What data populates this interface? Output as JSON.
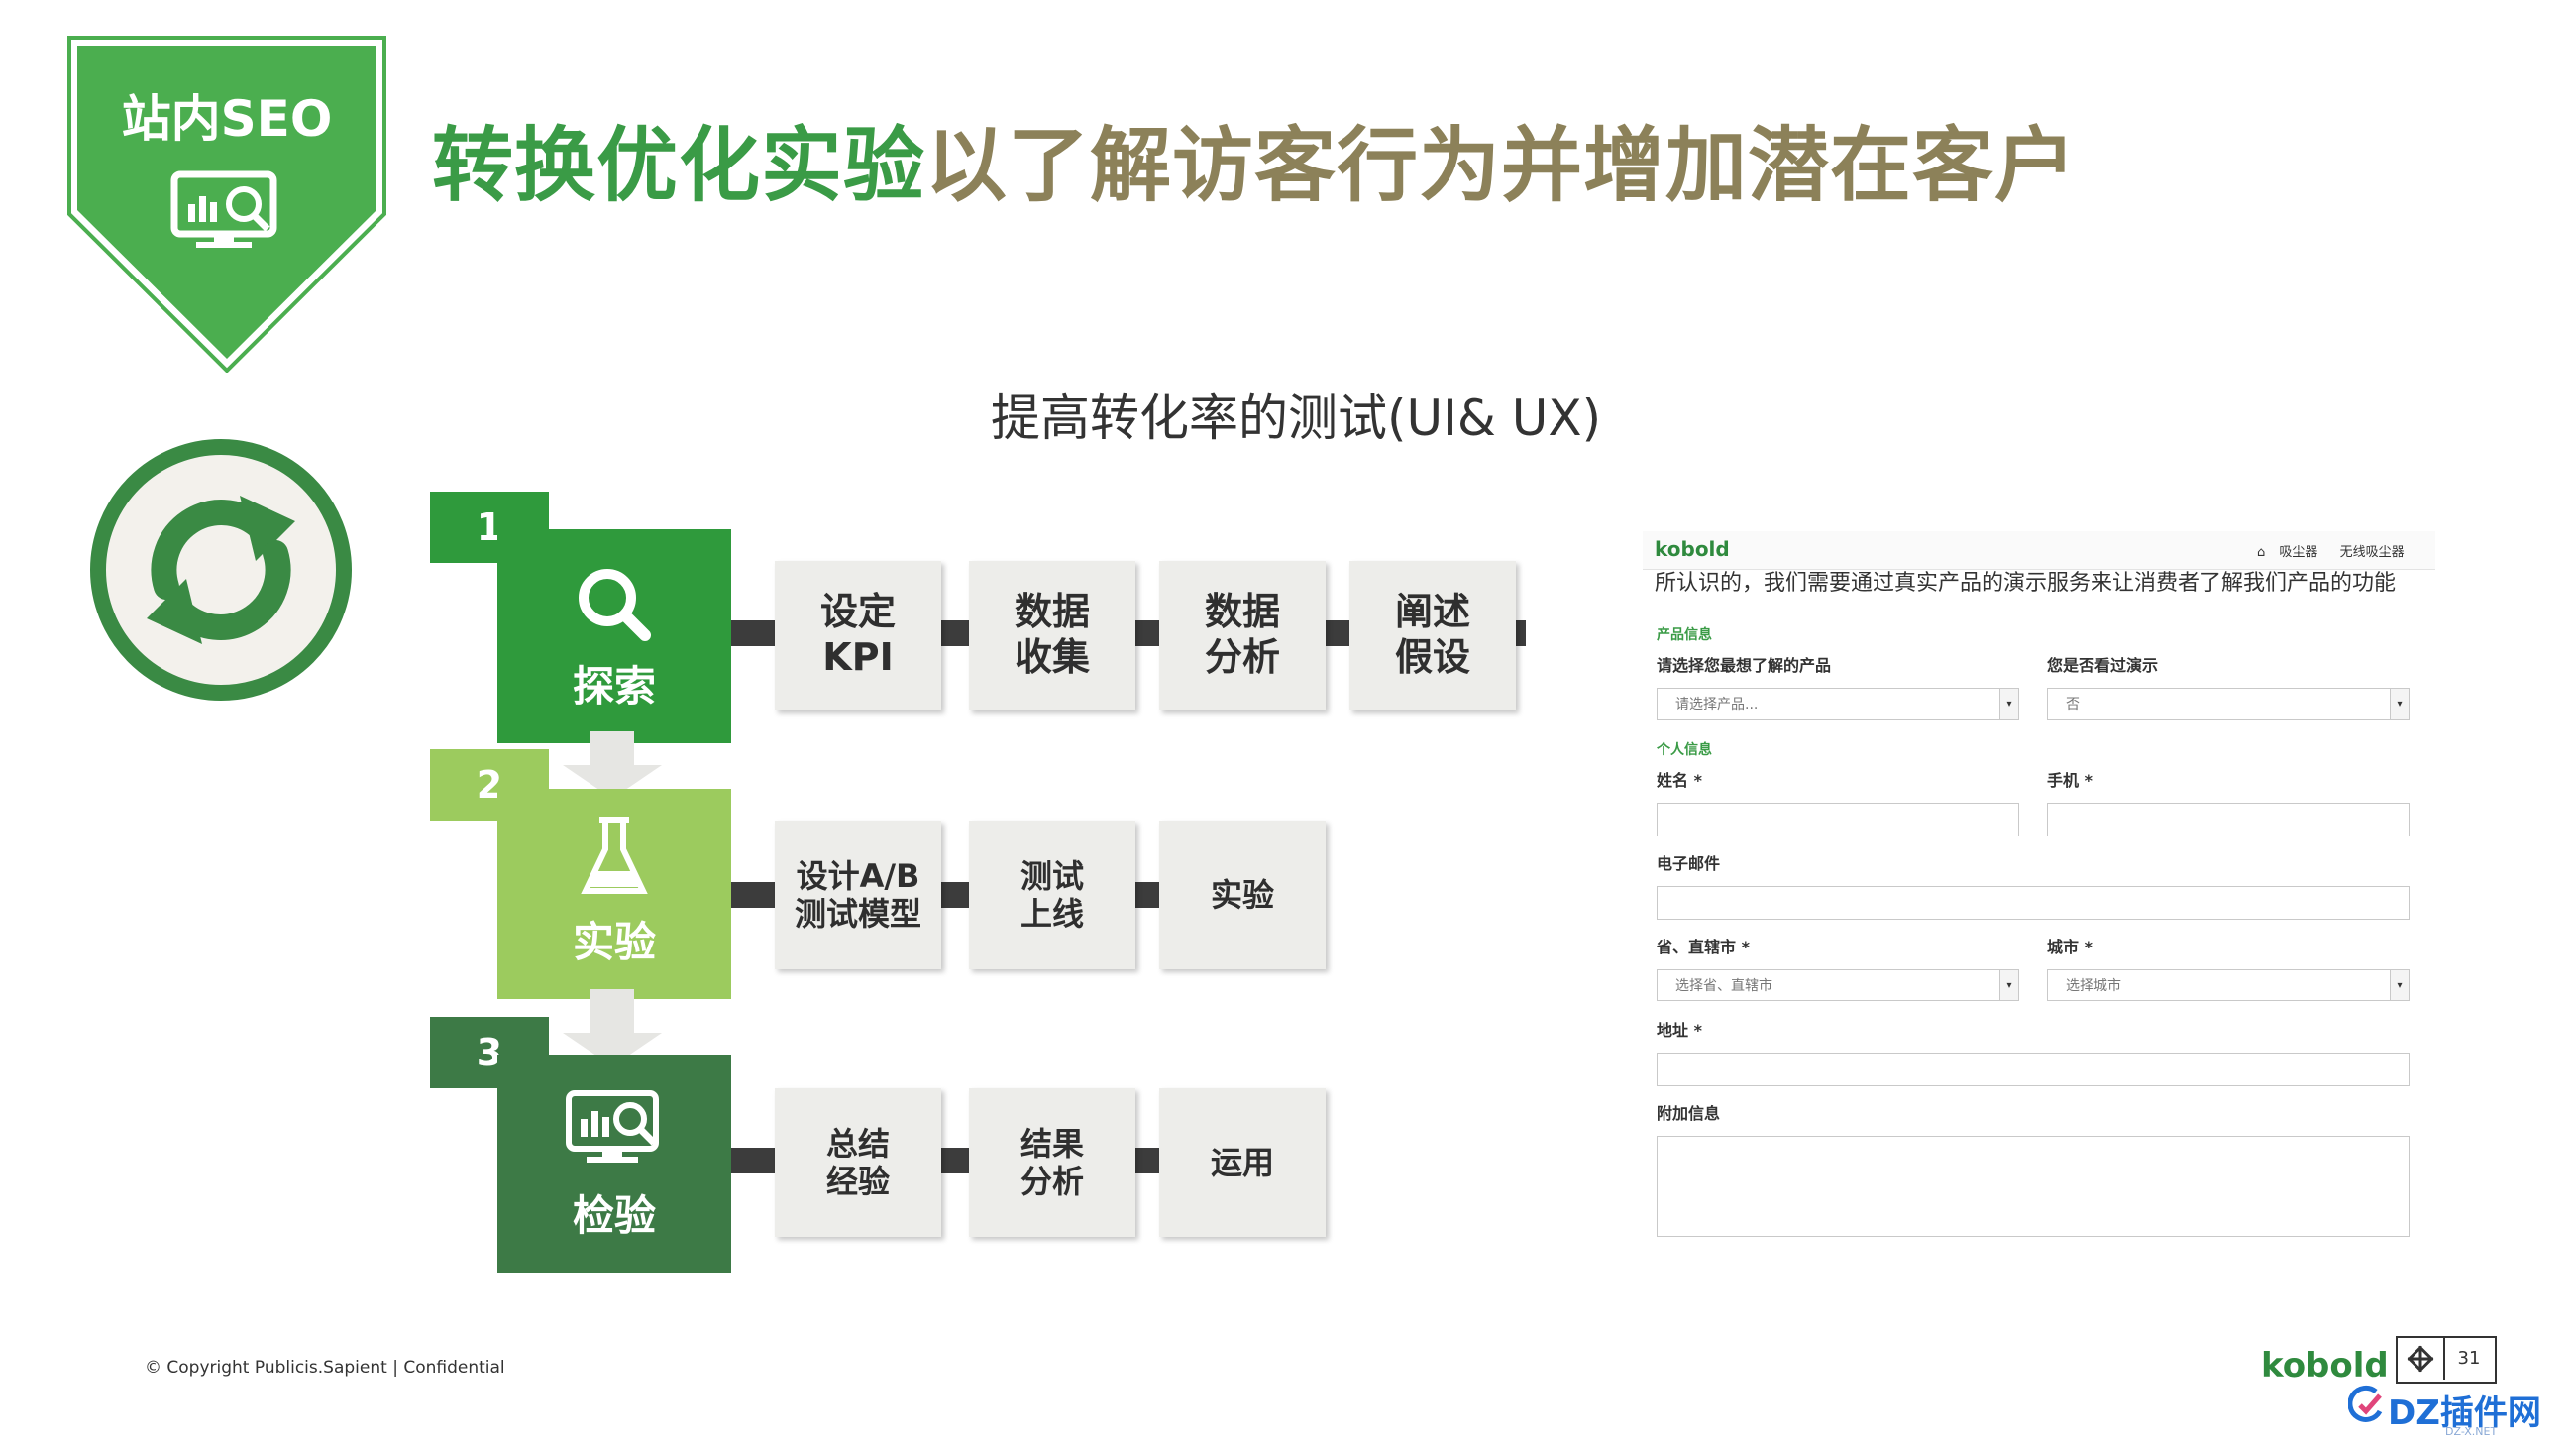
{
  "badge": {
    "label": "站内SEO",
    "icon": "analytics-search-icon",
    "color": "#4bae4f"
  },
  "title": {
    "part1": "转换优化实验",
    "part2": "以了解访客行为并增加潜在客户",
    "color1": "#3a9b46",
    "color2": "#8c8159"
  },
  "subtitle": "提高转化率的测试(UI& UX)",
  "refresh_icon": "refresh-cycle-icon",
  "steps": [
    {
      "number": "1",
      "label": "探索",
      "icon": "magnifier-icon",
      "color": "#2f9a3c",
      "boxes": [
        "设定\nKPI",
        "数据\n收集",
        "数据\n分析",
        "阐述\n假设"
      ]
    },
    {
      "number": "2",
      "label": "实验",
      "icon": "flask-icon",
      "color": "#9ccb5e",
      "boxes": [
        "设计A/B\n测试模型",
        "测试\n上线",
        "实验"
      ]
    },
    {
      "number": "3",
      "label": "检验",
      "icon": "analytics-screen-icon",
      "color": "#3d7a46",
      "boxes": [
        "总结\n经验",
        "结果\n分析",
        "运用"
      ]
    }
  ],
  "form": {
    "logo": "kobold",
    "nav": [
      "吸尘器",
      "无线吸尘器"
    ],
    "intro": "所认识的，我们需要通过真实产品的演示服务来让消费者了解我们产品的功能",
    "section_product": "产品信息",
    "label_product": "请选择您最想了解的产品",
    "select_product": "请选择产品...",
    "label_seen": "您是否看过演示",
    "select_seen": "否",
    "section_personal": "个人信息",
    "label_name": "姓名 *",
    "label_phone": "手机 *",
    "label_email": "电子邮件",
    "label_province": "省、直辖市 *",
    "select_province": "选择省、直辖市",
    "label_city": "城市 *",
    "select_city": "选择城市",
    "label_address": "地址 *",
    "label_extra": "附加信息"
  },
  "footer": {
    "copyright": "© Copyright Publicis.Sapient | Confidential",
    "brand": "kobold",
    "page": "31",
    "watermark": "DZ插件网",
    "watermark_sub": "DZ-X.NET"
  }
}
